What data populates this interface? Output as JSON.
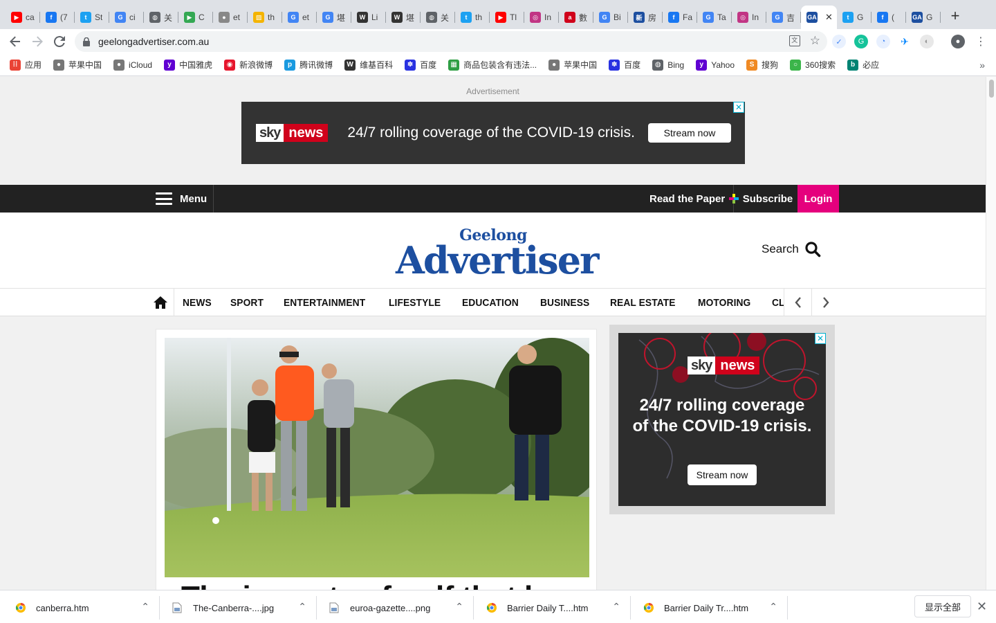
{
  "tabs": [
    {
      "label": "ca",
      "icon": "youtube-icon",
      "color": "#ff0000",
      "glyph": "▶"
    },
    {
      "label": "(7",
      "icon": "facebook-icon",
      "color": "#1877f2",
      "glyph": "f"
    },
    {
      "label": "St",
      "icon": "twitter-icon",
      "color": "#1da1f2",
      "glyph": "t"
    },
    {
      "label": "ci",
      "icon": "google-icon",
      "color": "#4285f4",
      "glyph": "G"
    },
    {
      "label": "关",
      "icon": "globe-icon",
      "color": "#5f6368",
      "glyph": "◍"
    },
    {
      "label": "C",
      "icon": "play-store-icon",
      "color": "#34a853",
      "glyph": "▶"
    },
    {
      "label": "et",
      "icon": "apple-icon",
      "color": "#888888",
      "glyph": "●"
    },
    {
      "label": "th",
      "icon": "page-icon",
      "color": "#f4b400",
      "glyph": "▨"
    },
    {
      "label": "et",
      "icon": "google-icon",
      "color": "#4285f4",
      "glyph": "G"
    },
    {
      "label": "堪",
      "icon": "google-icon",
      "color": "#4285f4",
      "glyph": "G"
    },
    {
      "label": "Li",
      "icon": "wikipedia-icon",
      "color": "#333333",
      "glyph": "W"
    },
    {
      "label": "堪",
      "icon": "wikipedia-icon",
      "color": "#333333",
      "glyph": "W"
    },
    {
      "label": "关",
      "icon": "globe-icon",
      "color": "#5f6368",
      "glyph": "◍"
    },
    {
      "label": "th",
      "icon": "twitter-icon",
      "color": "#1da1f2",
      "glyph": "t"
    },
    {
      "label": "Tl",
      "icon": "youtube-icon",
      "color": "#ff0000",
      "glyph": "▶"
    },
    {
      "label": "In",
      "icon": "instagram-icon",
      "color": "#c13584",
      "glyph": "◎"
    },
    {
      "label": "數",
      "icon": "abc-icon",
      "color": "#d0021b",
      "glyph": "a"
    },
    {
      "label": "Bi",
      "icon": "google-icon",
      "color": "#4285f4",
      "glyph": "G"
    },
    {
      "label": "房",
      "icon": "news-icon",
      "color": "#1d4fa0",
      "glyph": "新"
    },
    {
      "label": "Fa",
      "icon": "facebook-icon",
      "color": "#1877f2",
      "glyph": "f"
    },
    {
      "label": "Ta",
      "icon": "google-icon",
      "color": "#4285f4",
      "glyph": "G"
    },
    {
      "label": "In",
      "icon": "instagram-icon",
      "color": "#c13584",
      "glyph": "◎"
    },
    {
      "label": "吉",
      "icon": "google-icon",
      "color": "#4285f4",
      "glyph": "G"
    },
    {
      "label": "",
      "icon": "geelong-advertiser-icon",
      "color": "#1d4fa0",
      "glyph": "GA",
      "active": true
    },
    {
      "label": "G",
      "icon": "twitter-icon",
      "color": "#1da1f2",
      "glyph": "t"
    },
    {
      "label": "(",
      "icon": "facebook-icon",
      "color": "#1877f2",
      "glyph": "f"
    },
    {
      "label": "G",
      "icon": "geelong-advertiser-icon",
      "color": "#1d4fa0",
      "glyph": "GA"
    }
  ],
  "url": "geelongadvertiser.com.au",
  "bookmarks": [
    {
      "label": "应用",
      "icon": "apps-grid-icon",
      "color": "#ea4335",
      "glyph": "⁞⁞"
    },
    {
      "label": "苹果中国",
      "icon": "apple-icon",
      "color": "#777777",
      "glyph": "●"
    },
    {
      "label": "iCloud",
      "icon": "apple-icon",
      "color": "#777777",
      "glyph": "●"
    },
    {
      "label": "中国雅虎",
      "icon": "yahoo-icon",
      "color": "#6001d2",
      "glyph": "y"
    },
    {
      "label": "新浪微博",
      "icon": "weibo-icon",
      "color": "#e6162d",
      "glyph": "◉"
    },
    {
      "label": "腾讯微博",
      "icon": "tencent-icon",
      "color": "#1a9ae0",
      "glyph": "p"
    },
    {
      "label": "维基百科",
      "icon": "wikipedia-icon",
      "color": "#333333",
      "glyph": "W"
    },
    {
      "label": "百度",
      "icon": "baidu-icon",
      "color": "#2932e1",
      "glyph": "✽"
    },
    {
      "label": "商品包装含有违法...",
      "icon": "page-icon",
      "color": "#2e9e44",
      "glyph": "▦"
    },
    {
      "label": "苹果中国",
      "icon": "apple-icon",
      "color": "#777777",
      "glyph": "●"
    },
    {
      "label": "百度",
      "icon": "baidu-icon",
      "color": "#2932e1",
      "glyph": "✽"
    },
    {
      "label": "Bing",
      "icon": "globe-icon",
      "color": "#5f6368",
      "glyph": "◍"
    },
    {
      "label": "Yahoo",
      "icon": "yahoo-icon",
      "color": "#6001d2",
      "glyph": "y"
    },
    {
      "label": "搜狗",
      "icon": "sogou-icon",
      "color": "#f08a24",
      "glyph": "S"
    },
    {
      "label": "360搜索",
      "icon": "search-360-icon",
      "color": "#3bb54a",
      "glyph": "○"
    },
    {
      "label": "必应",
      "icon": "bing-icon",
      "color": "#008373",
      "glyph": "b"
    }
  ],
  "ad_label": "Advertisement",
  "banner_ad": {
    "logo_sky": "sky",
    "logo_news": "news",
    "headline": "24/7 rolling coverage of the COVID-19 crisis.",
    "cta": "Stream now"
  },
  "topbar": {
    "menu": "Menu",
    "read_paper": "Read the Paper",
    "subscribe": "Subscribe",
    "login": "Login"
  },
  "masthead": {
    "logo_small": "Geelong",
    "logo_big": "Advertiser",
    "search": "Search"
  },
  "sections": [
    "NEWS",
    "SPORT",
    "ENTERTAINMENT",
    "LIFESTYLE",
    "EDUCATION",
    "BUSINESS",
    "REAL ESTATE",
    "MOTORING",
    "CLASSIFIEDS"
  ],
  "article": {
    "headline": "The impacts of golf that have"
  },
  "side_ad": {
    "logo_sky": "sky",
    "logo_news": "news",
    "line1": "24/7 rolling coverage",
    "line2": "of the COVID-19 crisis.",
    "cta": "Stream now"
  },
  "downloads": [
    {
      "name": "canberra.htm",
      "type": "chrome-file-icon"
    },
    {
      "name": "The-Canberra-....jpg",
      "type": "image-file-icon"
    },
    {
      "name": "euroa-gazette....png",
      "type": "image-file-icon"
    },
    {
      "name": "Barrier Daily T....htm",
      "type": "chrome-file-icon"
    },
    {
      "name": "Barrier Daily Tr....htm",
      "type": "chrome-file-icon"
    }
  ],
  "show_all": "显示全部",
  "colors": {
    "brand_blue": "#1d4fa0",
    "login_pink": "#e5007d",
    "sky_red": "#d0021b",
    "topbar_black": "#222222"
  }
}
